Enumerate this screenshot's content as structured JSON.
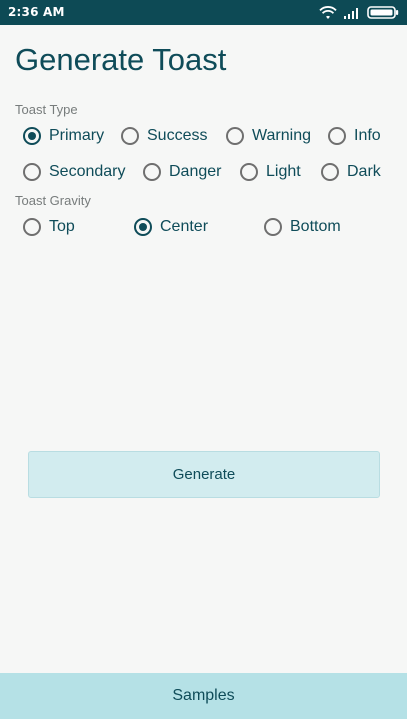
{
  "status_bar": {
    "time": "2:36 AM",
    "icons": [
      "wifi-icon",
      "signal-icon",
      "battery-icon"
    ]
  },
  "title": "Generate Toast",
  "toast_type": {
    "label": "Toast Type",
    "options": [
      "Primary",
      "Success",
      "Warning",
      "Info",
      "Secondary",
      "Danger",
      "Light",
      "Dark"
    ],
    "selected": "Primary"
  },
  "toast_gravity": {
    "label": "Toast Gravity",
    "options": [
      "Top",
      "Center",
      "Bottom"
    ],
    "selected": "Center"
  },
  "generate_button": {
    "label": "Generate"
  },
  "bottom_bar": {
    "label": "Samples"
  },
  "colors": {
    "accent": "#0f4c59",
    "status_bar": "#0d4a55",
    "button_fill": "#d2ecef",
    "bottom_bar_fill": "#b5e1e6"
  }
}
